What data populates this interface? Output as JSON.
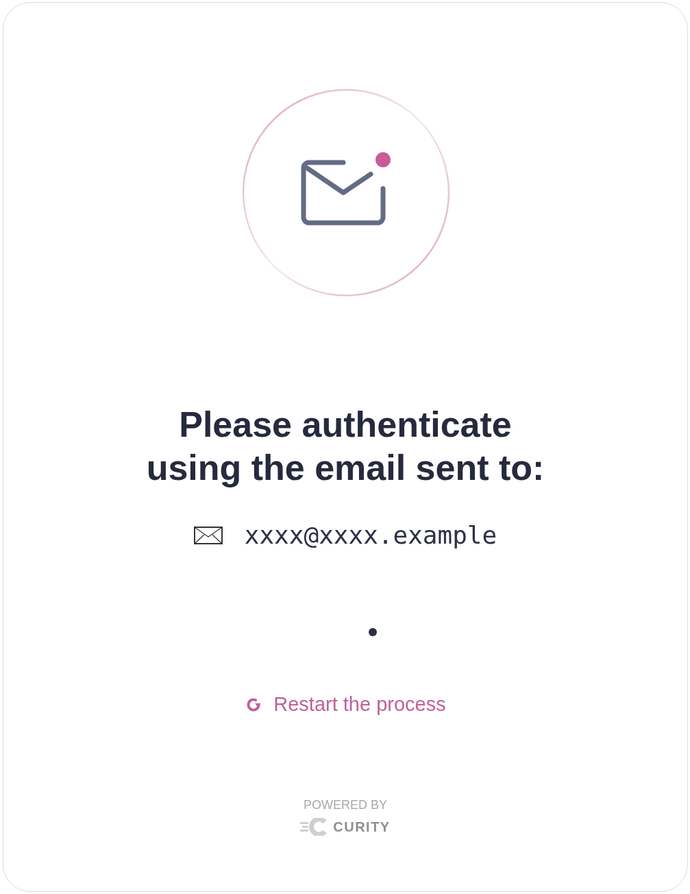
{
  "heading": "Please authenticate using the email sent to:",
  "email": "xxxx@xxxx.example",
  "restart_link": "Restart the process",
  "footer": {
    "powered_by": "POWERED BY",
    "brand": "CURITY"
  }
}
